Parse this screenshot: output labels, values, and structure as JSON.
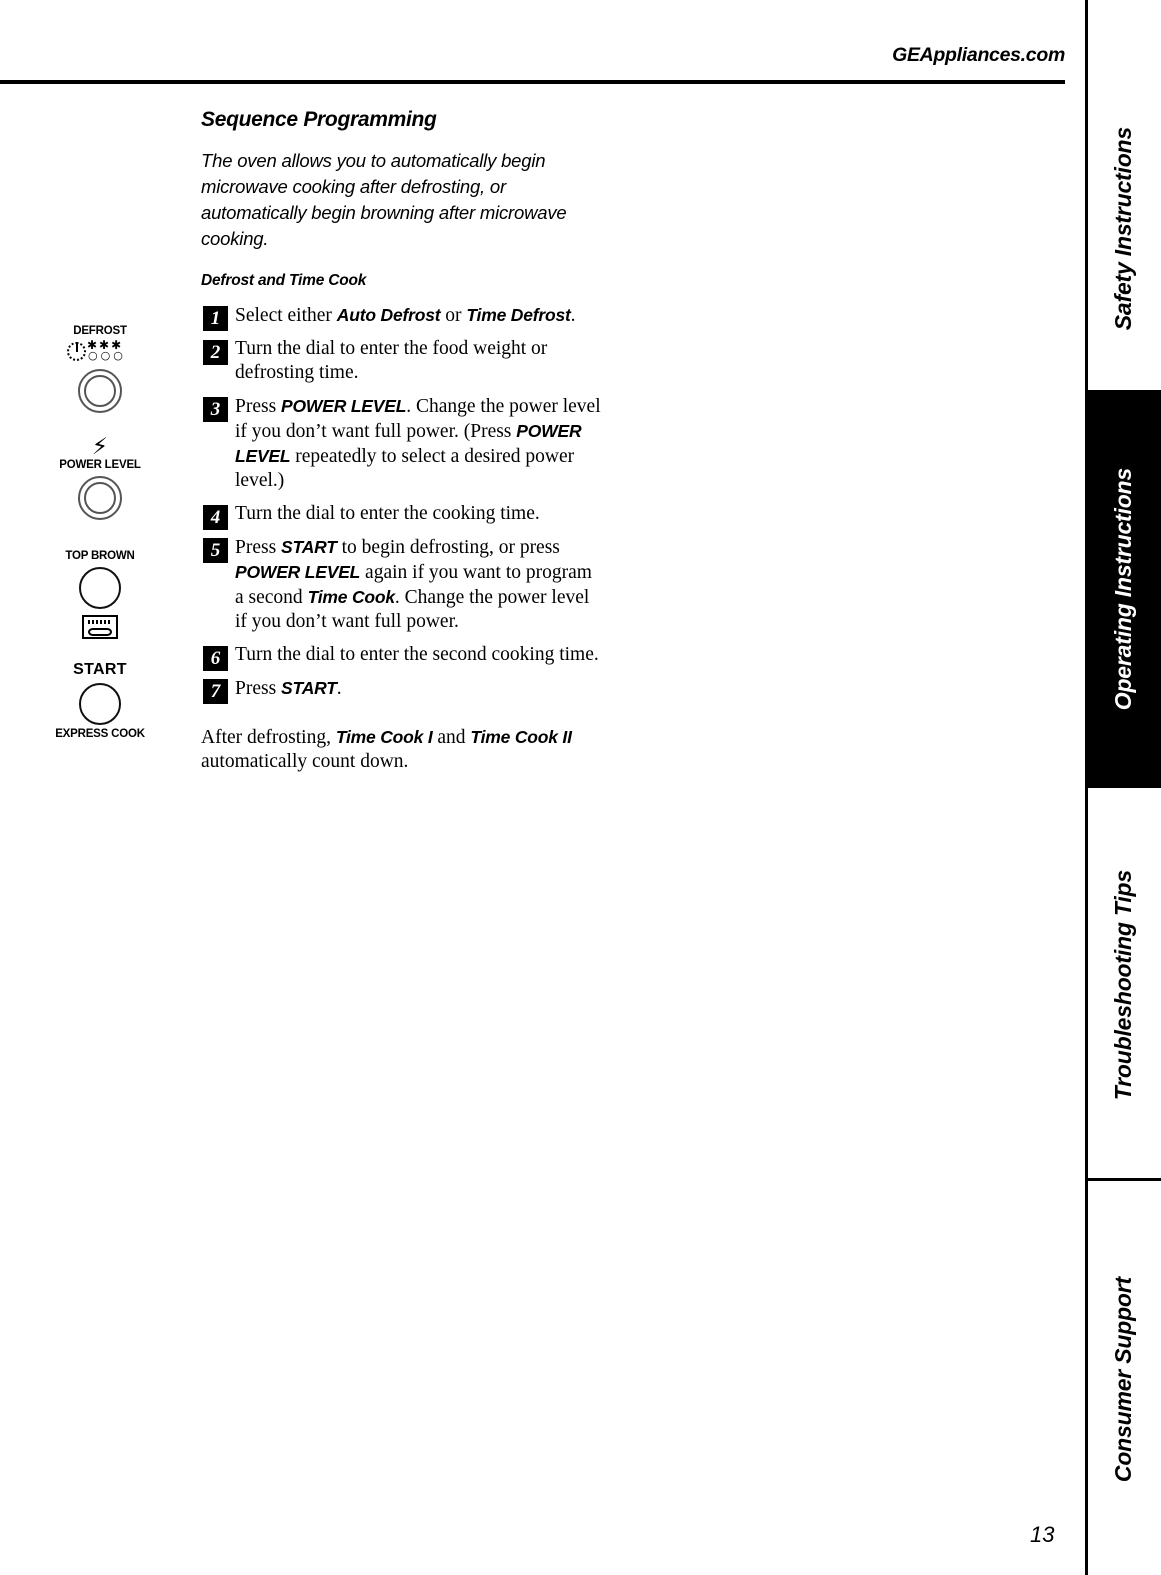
{
  "header": {
    "site": "GEAppliances.com"
  },
  "page": {
    "number": "13"
  },
  "tabs": [
    {
      "label": "Safety Instructions",
      "active": false
    },
    {
      "label": "Operating Instructions",
      "active": true
    },
    {
      "label": "Troubleshooting Tips",
      "active": false
    },
    {
      "label": "Consumer Support",
      "active": false
    }
  ],
  "panel": {
    "defrost": {
      "caption": "DEFROST",
      "snowflakes": "✱✱✱",
      "droplets": "○○○"
    },
    "power_level": {
      "caption": "POWER LEVEL",
      "bolt": "⚡"
    },
    "top_brown": {
      "caption": "TOP BROWN"
    },
    "start": {
      "caption": "START",
      "sub_caption": "EXPRESS COOK"
    }
  },
  "content": {
    "section_title": "Sequence Programming",
    "intro": "The oven allows you to automatically begin microwave cooking after defrosting, or automatically begin browning after microwave cooking.",
    "subsection_title": "Defrost and Time Cook",
    "steps": [
      {
        "number": "1",
        "parts": [
          {
            "t": "Select either ",
            "b": false
          },
          {
            "t": "Auto Defrost",
            "b": true
          },
          {
            "t": " or ",
            "b": false
          },
          {
            "t": "Time Defrost",
            "b": true
          },
          {
            "t": ".",
            "b": false
          }
        ]
      },
      {
        "number": "2",
        "parts": [
          {
            "t": "Turn the dial to enter the food weight or defrosting time.",
            "b": false
          }
        ]
      },
      {
        "number": "3",
        "parts": [
          {
            "t": "Press ",
            "b": false
          },
          {
            "t": "POWER LEVEL",
            "b": true
          },
          {
            "t": ". Change the power level if you don’t want full power. (Press ",
            "b": false
          },
          {
            "t": "POWER LEVEL",
            "b": true
          },
          {
            "t": " repeatedly to select a desired power level.)",
            "b": false
          }
        ]
      },
      {
        "number": "4",
        "parts": [
          {
            "t": "Turn the dial to enter the cooking time.",
            "b": false
          }
        ]
      },
      {
        "number": "5",
        "parts": [
          {
            "t": "Press ",
            "b": false
          },
          {
            "t": "START",
            "b": true
          },
          {
            "t": " to begin defrosting, or press ",
            "b": false
          },
          {
            "t": "POWER LEVEL",
            "b": true
          },
          {
            "t": " again if you want to program a second ",
            "b": false
          },
          {
            "t": "Time Cook",
            "b": true
          },
          {
            "t": ". Change the power level if you don’t want full power.",
            "b": false
          }
        ]
      },
      {
        "number": "6",
        "parts": [
          {
            "t": "Turn the dial to enter the second cooking time.",
            "b": false
          }
        ]
      },
      {
        "number": "7",
        "parts": [
          {
            "t": "Press ",
            "b": false
          },
          {
            "t": "START",
            "b": true
          },
          {
            "t": ".",
            "b": false
          }
        ]
      }
    ],
    "closing": [
      {
        "t": "After defrosting, ",
        "b": false
      },
      {
        "t": "Time Cook I",
        "b": true
      },
      {
        "t": " and ",
        "b": false
      },
      {
        "t": "Time Cook II",
        "b": true
      },
      {
        "t": " automatically count down.",
        "b": false
      }
    ]
  }
}
